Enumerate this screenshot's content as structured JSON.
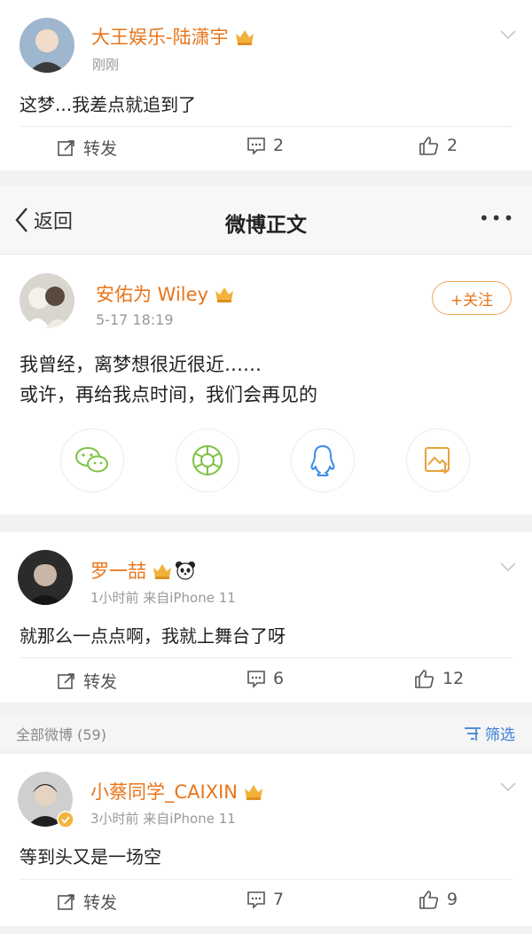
{
  "post1": {
    "username": "大王娱乐-陆潇宇",
    "meta": "刚刚",
    "text": "这梦...我差点就追到了",
    "repost_label": "转发",
    "comment_count": "2",
    "like_count": "2"
  },
  "navbar": {
    "back_label": "返回",
    "title": "微博正文",
    "more": "•••"
  },
  "main_post": {
    "username": "安佑为 Wiley",
    "date": "5-17 18:19",
    "follow_label": "+关注",
    "line1": "我曾经，离梦想很近很近……",
    "line2": "或许，再给我点时间，我们会再见的",
    "share_icons": [
      "wechat-icon",
      "moments-icon",
      "qq-icon",
      "save-image-icon"
    ]
  },
  "post2": {
    "username": "罗一喆",
    "meta": "1小时前  来自iPhone 11",
    "text": "就那么一点点啊，我就上舞台了呀",
    "repost_label": "转发",
    "comment_count": "6",
    "like_count": "12"
  },
  "filter_bar": {
    "label": "全部微博 (59)",
    "filter_label": "筛选"
  },
  "post3": {
    "username": "小蔡同学_CAIXIN",
    "meta": "3小时前  来自iPhone 11",
    "text": "等到头又是一场空",
    "repost_label": "转发",
    "comment_count": "7",
    "like_count": "9"
  },
  "colors": {
    "username": "#e8751a",
    "accent_green": "#7cc242",
    "accent_blue": "#3b8de8",
    "accent_orange": "#e8a33a"
  }
}
